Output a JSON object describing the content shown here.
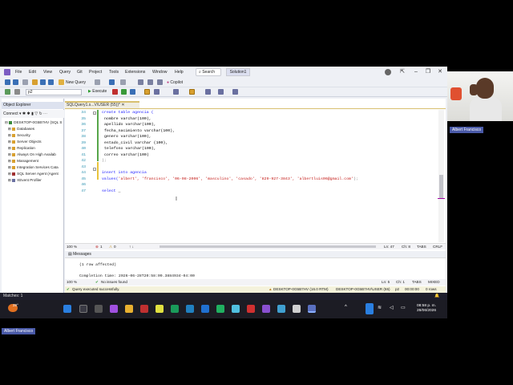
{
  "menu": {
    "items": [
      "File",
      "Edit",
      "View",
      "Query",
      "Git",
      "Project",
      "Tools",
      "Extensions",
      "Window",
      "Help"
    ],
    "search": "Search",
    "solution": "Solution1"
  },
  "toolbar": {
    "new_query": "New Query",
    "database": "p2",
    "execute": "Execute",
    "copilot": "Copilot"
  },
  "object_explorer": {
    "title": "Object Explorer",
    "connect": "Connect",
    "server": "DESKTOP-0G5B7HV (SQL S",
    "nodes": [
      "Databases",
      "Security",
      "Server Objects",
      "Replication",
      "Always On High Availab",
      "Management",
      "Integration Services Cata",
      "SQL Server Agent (Agent",
      "XEvent Profiler"
    ]
  },
  "editor": {
    "tab_label": "SQLQuery1.s...V\\USER (55))*",
    "line_numbers": [
      "34",
      "35",
      "36",
      "37",
      "38",
      "39",
      "40",
      "41",
      "42",
      "43",
      "44",
      "45",
      "46",
      "47"
    ],
    "lines": [
      {
        "kw": "create table agencia (",
        "str": "",
        "rest": ""
      },
      {
        "kw": "",
        "str": "",
        "rest": "nombre varchar(100),"
      },
      {
        "kw": "",
        "str": "",
        "rest": "apellido varchar(100),"
      },
      {
        "kw": "",
        "str": "",
        "rest": "fecha_nacimiento varchar(100),"
      },
      {
        "kw": "",
        "str": "",
        "rest": "genero varchar(100),"
      },
      {
        "kw": "",
        "str": "",
        "rest": "estado_civil varchar (100),"
      },
      {
        "kw": "",
        "str": "",
        "rest": "telefono varchar(100),"
      },
      {
        "kw": "",
        "str": "",
        "rest": "correo varchar(100)"
      },
      {
        "kw": "",
        "str": "",
        "rest": ");"
      },
      {
        "kw": "",
        "str": "",
        "rest": ""
      },
      {
        "kw": "insert into agencia",
        "str": "",
        "rest": ""
      },
      {
        "kw": "values(",
        "str": "'albert', 'francisco', '06-08-2006', 'masculino', 'casado', '829-927-3843', 'albertluis06@gmail.com'",
        "rest": ");"
      },
      {
        "kw": "",
        "str": "",
        "rest": ""
      },
      {
        "kw": "select ",
        "str": "",
        "rest": ""
      }
    ],
    "zoom": "100 %",
    "errors": "1",
    "warnings": "0",
    "position": {
      "ln": "Ln: 47",
      "ch": "Ch: 8",
      "tabs": "TABS",
      "crlf": "CRLF"
    }
  },
  "results": {
    "tab": "Messages",
    "line1": "(1 row affected)",
    "line2": "Completion time: 2026-06-28T20:58:09.3884934-04:00",
    "zoom": "100 %",
    "no_issues": "No issues found",
    "position": {
      "ln": "Ln: 5",
      "ch": "Ch: 1",
      "tabs": "TABS",
      "mixed": "MIXED"
    }
  },
  "query_status": {
    "message": "Query executed successfully.",
    "server": "DESKTOP-0G5B7HV (16.0 RTM)",
    "user": "DESKTOP-0G5B7HV\\USER (55)",
    "db": "p2",
    "time": "00:00:00",
    "rows": "0 rows"
  },
  "statusbar": {
    "text": "Matches: 1"
  },
  "taskbar": {
    "temp": "28°",
    "time": "08:58 p. m.",
    "date": "28/06/2026"
  },
  "webcam": {
    "name": "Albert Francisco"
  },
  "colors": {
    "accent": "#68217a",
    "keyword": "#1a1aff",
    "string": "#c41a16",
    "taskbar": "#1c1c24"
  }
}
